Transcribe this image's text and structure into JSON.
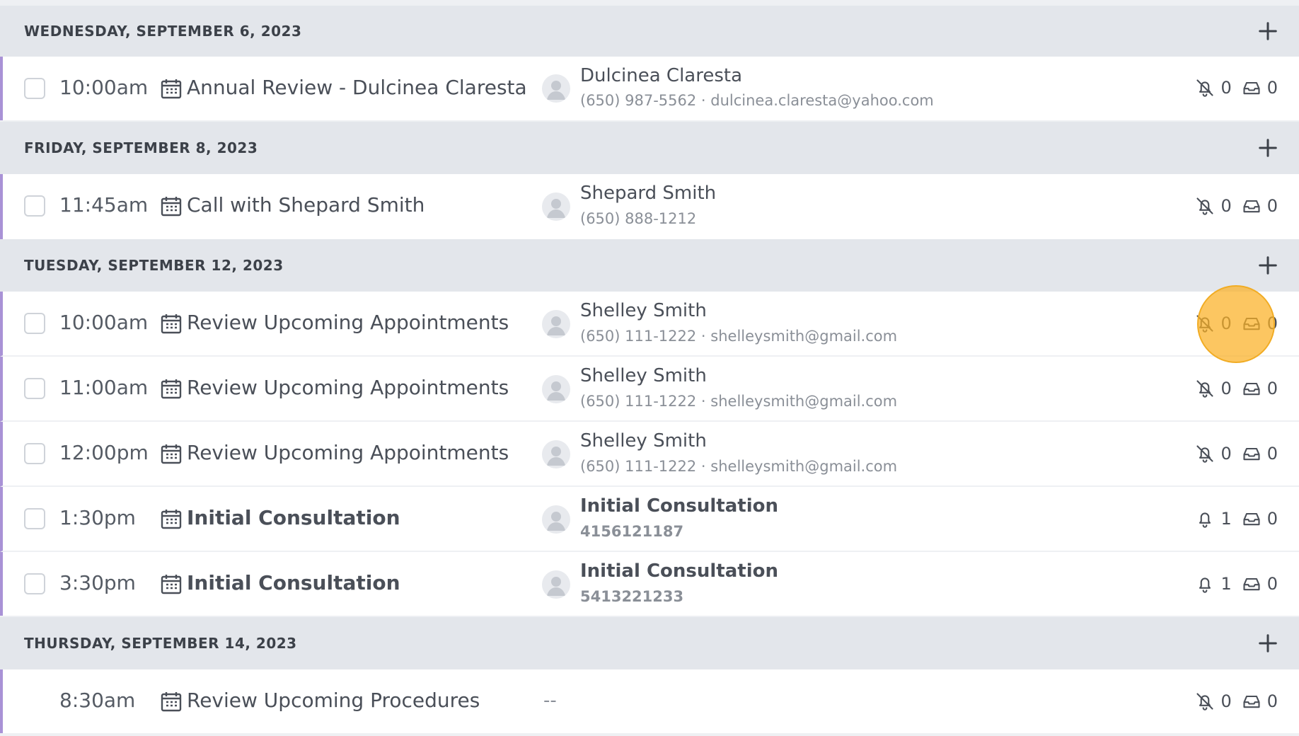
{
  "colors": {
    "row_accent": "#a992d6",
    "header_bg": "#e3e6eb",
    "highlight": "#fbb024"
  },
  "groups": [
    {
      "date": "WEDNESDAY, SEPTEMBER 6, 2023",
      "add_icon": "plus-icon",
      "events": [
        {
          "time": "10:00am",
          "title": "Annual Review - Dulcinea Claresta",
          "contact_name": "Dulcinea Claresta",
          "contact_details": "(650) 987-5562 · dulcinea.claresta@yahoo.com",
          "reminders": "0",
          "messages": "0"
        }
      ]
    },
    {
      "date": "FRIDAY, SEPTEMBER 8, 2023",
      "add_icon": "plus-icon",
      "events": [
        {
          "time": "11:45am",
          "title": "Call with Shepard Smith",
          "contact_name": "Shepard Smith",
          "contact_details": "(650) 888-1212",
          "reminders": "0",
          "messages": "0"
        }
      ]
    },
    {
      "date": "TUESDAY, SEPTEMBER 12, 2023",
      "add_icon": "plus-icon",
      "events": [
        {
          "time": "10:00am",
          "title": "Review Upcoming Appointments",
          "contact_name": "Shelley Smith",
          "contact_details": "(650) 111-1222 · shelleysmith@gmail.com",
          "reminders": "0",
          "messages": "0"
        },
        {
          "time": "11:00am",
          "title": "Review Upcoming Appointments",
          "contact_name": "Shelley Smith",
          "contact_details": "(650) 111-1222 · shelleysmith@gmail.com",
          "reminders": "0",
          "messages": "0"
        },
        {
          "time": "12:00pm",
          "title": "Review Upcoming Appointments",
          "contact_name": "Shelley Smith",
          "contact_details": "(650) 111-1222 · shelleysmith@gmail.com",
          "reminders": "0",
          "messages": "0"
        },
        {
          "time": "1:30pm",
          "title": "Initial Consultation",
          "contact_name": "Initial Consultation",
          "contact_details": "4156121187",
          "reminders": "1",
          "messages": "0"
        },
        {
          "time": "3:30pm",
          "title": "Initial Consultation",
          "contact_name": "Initial Consultation",
          "contact_details": "5413221233",
          "reminders": "1",
          "messages": "0"
        }
      ]
    },
    {
      "date": "THURSDAY, SEPTEMBER 14, 2023",
      "add_icon": "plus-icon",
      "events": [
        {
          "time": "8:30am",
          "title": "Review Upcoming Procedures",
          "contact_placeholder": "--",
          "reminders": "0",
          "messages": "0"
        }
      ]
    }
  ]
}
